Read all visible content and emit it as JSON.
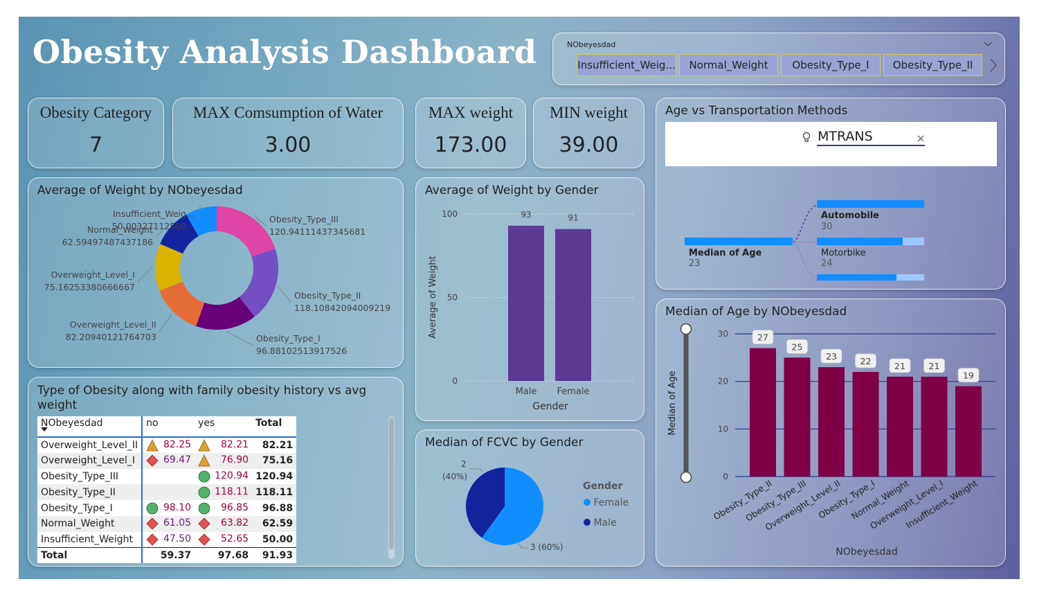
{
  "header": {
    "title": "Obesity Analysis Dashboard"
  },
  "slicer": {
    "label": "NObeyesdad",
    "items": [
      "Insufficient_Weig...",
      "Normal_Weight",
      "Obesity_Type_I",
      "Obesity_Type_II"
    ]
  },
  "kpis": [
    {
      "label": "Obesity Category",
      "value": "7"
    },
    {
      "label": "MAX Comsumption of Water",
      "value": "3.00"
    },
    {
      "label": "MAX weight",
      "value": "173.00"
    },
    {
      "label": "MIN weight",
      "value": "39.00"
    }
  ],
  "colors": {
    "accent_blue": "#118dff",
    "dark_blue": "#12239e",
    "bar_purple": "#5b3a94",
    "bar_maroon": "#800047"
  },
  "donut": {
    "title": "Average of Weight by NObeyesdad",
    "chart_data": {
      "type": "pie",
      "categories": [
        "Obesity_Type_III",
        "Obesity_Type_II",
        "Obesity_Type_I",
        "Overweight_Level_II",
        "Overweight_Level_I",
        "Normal_Weight",
        "Insufficient_Weig..."
      ],
      "values": [
        120.94111437345681,
        118.10842094009219,
        96.88102513917526,
        82.20940121764703,
        75.16253380666667,
        62.59497487437186,
        50.003271125
      ],
      "value_labels": [
        "120.94111437345681",
        "118.10842094009219",
        "96.88102513917526",
        "82.20940121764703",
        "75.16253380666667",
        "62.59497487437186",
        "50.00327112500..."
      ],
      "colors": [
        "#e044a7",
        "#744ec2",
        "#6b007b",
        "#e66c37",
        "#d9b300",
        "#12239e",
        "#118dff"
      ]
    }
  },
  "gender_bar": {
    "title": "Average of Weight by Gender",
    "chart_data": {
      "type": "bar",
      "categories": [
        "Male",
        "Female"
      ],
      "values": [
        93,
        91
      ],
      "value_labels": [
        "93",
        "91"
      ],
      "xlabel": "Gender",
      "ylabel": "Average of Weight",
      "ylim": [
        0,
        100
      ],
      "yticks": [
        "0",
        "50",
        "100"
      ]
    }
  },
  "fcvc_pie": {
    "title": "Median of FCVC by Gender",
    "legend_title": "Gender",
    "legend": [
      "Female",
      "Male"
    ],
    "label_male": "2",
    "label_male_pct": "(40%)",
    "label_female": "3 (60%)",
    "chart_data": {
      "type": "pie",
      "categories": [
        "Female",
        "Male"
      ],
      "values": [
        3,
        2
      ],
      "percent": [
        60,
        40
      ],
      "colors": [
        "#118dff",
        "#12239e"
      ]
    }
  },
  "decomp": {
    "title": "Age vs Transportation Methods",
    "field": "MTRANS",
    "root_label": "Median of Age",
    "root_value": "23",
    "nodes": [
      {
        "label": "Automobile",
        "value": "30",
        "level": 1.0
      },
      {
        "label": "Motorbike",
        "value": "24",
        "level": 0.8
      },
      {
        "label": "",
        "value": "",
        "level": 0.74
      }
    ]
  },
  "age_bar": {
    "title": "Median of Age by NObeyesdad",
    "chart_data": {
      "type": "bar",
      "categories": [
        "Obesity_Type_II",
        "Obesity_Type_III",
        "Overweight_Level_II",
        "Obesity_Type_I",
        "Normal_Weight",
        "Overweight_Level_I",
        "Insufficient_Weight"
      ],
      "values": [
        27,
        25,
        23,
        22,
        21,
        21,
        19
      ],
      "value_labels": [
        "27",
        "25",
        "23",
        "22",
        "21",
        "21",
        "19"
      ],
      "xlabel": "NObeyesdad",
      "ylabel": "Median of Age",
      "ylim": [
        0,
        30
      ],
      "yticks": [
        "0",
        "10",
        "20",
        "30"
      ]
    }
  },
  "matrix": {
    "title": "Type of Obesity along with family obesity history vs avg weight",
    "headers": [
      "NObeyesdad",
      "no",
      "yes",
      "Total"
    ],
    "rows": [
      {
        "name": "Overweight_Level_II",
        "no": "82.25",
        "no_icon": "triangle",
        "yes": "82.21",
        "yes_icon": "triangle",
        "total": "82.21"
      },
      {
        "name": "Overweight_Level_I",
        "no": "69.47",
        "no_icon": "diamond",
        "yes": "76.90",
        "yes_icon": "triangle",
        "total": "75.16"
      },
      {
        "name": "Obesity_Type_III",
        "no": "",
        "no_icon": "",
        "yes": "120.94",
        "yes_icon": "circle",
        "total": "120.94"
      },
      {
        "name": "Obesity_Type_II",
        "no": "",
        "no_icon": "",
        "yes": "118.11",
        "yes_icon": "circle",
        "total": "118.11"
      },
      {
        "name": "Obesity_Type_I",
        "no": "98.10",
        "no_icon": "circle",
        "yes": "96.85",
        "yes_icon": "circle",
        "total": "96.88"
      },
      {
        "name": "Normal_Weight",
        "no": "61.05",
        "no_icon": "diamond",
        "yes": "63.82",
        "yes_icon": "diamond",
        "total": "62.59"
      },
      {
        "name": "Insufficient_Weight",
        "no": "47.50",
        "no_icon": "diamond",
        "yes": "52.65",
        "yes_icon": "diamond",
        "total": "50.00"
      }
    ],
    "total": {
      "name": "Total",
      "no": "59.37",
      "yes": "97.68",
      "total": "91.93"
    }
  }
}
